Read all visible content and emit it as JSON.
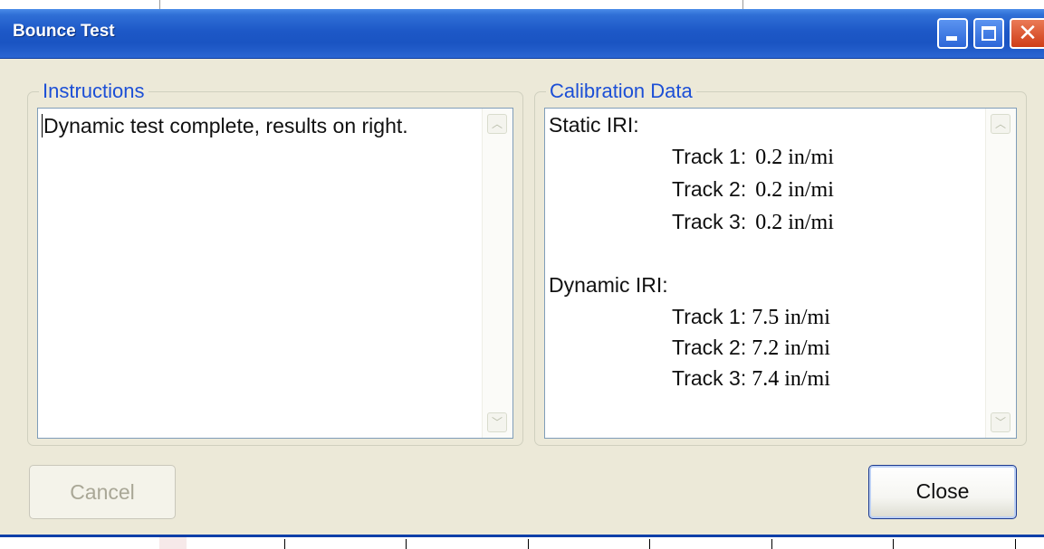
{
  "window": {
    "title": "Bounce Test"
  },
  "instructions": {
    "label": "Instructions",
    "text": "Dynamic test complete, results on right."
  },
  "calibration": {
    "label": "Calibration Data",
    "static_heading": "Static IRI:",
    "static_tracks": [
      {
        "label": "Track 1:",
        "value": "0.2 in/mi"
      },
      {
        "label": "Track 2:",
        "value": "0.2 in/mi"
      },
      {
        "label": "Track 3:",
        "value": "0.2 in/mi"
      }
    ],
    "dynamic_heading": "Dynamic IRI:",
    "dynamic_tracks": [
      {
        "label": "Track 1:",
        "value": "7.5 in/mi"
      },
      {
        "label": "Track 2:",
        "value": "7.2 in/mi"
      },
      {
        "label": "Track 3:",
        "value": "7.4 in/mi"
      }
    ]
  },
  "buttons": {
    "cancel": "Cancel",
    "close": "Close"
  },
  "icons": {
    "minimize": "minimize-icon",
    "maximize": "maximize-icon",
    "close": "close-icon",
    "scroll_up": "arrow-up-icon",
    "scroll_down": "arrow-down-icon"
  },
  "colors": {
    "titlebar": "#1d58c7",
    "window_bg": "#ece9d8",
    "legend_text": "#1c4fd6",
    "close_button": "#cf3d17"
  }
}
